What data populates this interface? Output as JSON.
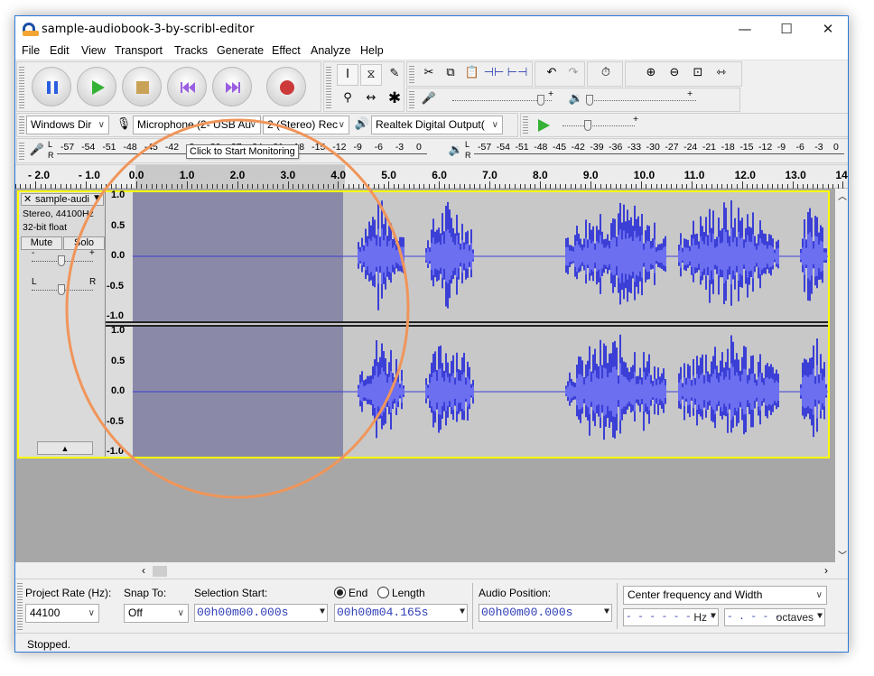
{
  "window": {
    "title": "sample-audiobook-3-by-scribl-editor",
    "min": "—",
    "max": "☐",
    "close": "✕"
  },
  "menu": [
    "File",
    "Edit",
    "View",
    "Transport",
    "Tracks",
    "Generate",
    "Effect",
    "Analyze",
    "Help"
  ],
  "tools": {
    "plus": "+"
  },
  "device": {
    "host": "Windows Dir",
    "input": "Microphone (2- USB Au",
    "channels": "2 (Stereo) Rec",
    "output": "Realtek Digital Output("
  },
  "meters": {
    "record_ticks": [
      "-57",
      "-54",
      "-51",
      "-48",
      "-45",
      "-42",
      "-3",
      "-30",
      "-27",
      "-24",
      "-21",
      "-18",
      "-15",
      "-12",
      "-9",
      "-6",
      "-3",
      "0"
    ],
    "play_ticks": [
      "-57",
      "-54",
      "-51",
      "-48",
      "-45",
      "-42",
      "-39",
      "-36",
      "-33",
      "-30",
      "-27",
      "-24",
      "-21",
      "-18",
      "-15",
      "-12",
      "-9",
      "-6",
      "-3",
      "0"
    ],
    "tooltip": "Click to Start Monitoring",
    "rec_left": "L",
    "rec_right": "R"
  },
  "timeline": {
    "ticks": [
      "- 2.0",
      "- 1.0",
      "0.0",
      "1.0",
      "2.0",
      "3.0",
      "4.0",
      "5.0",
      "6.0",
      "7.0",
      "8.0",
      "9.0",
      "10.0",
      "11.0",
      "12.0",
      "13.0",
      "14.0"
    ]
  },
  "track": {
    "name": "sample-audi",
    "info1": "Stereo, 44100Hz",
    "info2": "32-bit float",
    "mute": "Mute",
    "solo": "Solo",
    "minus": "-",
    "plus": "+",
    "pan_left": "L",
    "pan_right": "R",
    "collapse": "▲",
    "scale": [
      "1.0",
      "0.5",
      "0.0",
      "-0.5",
      "-1.0"
    ]
  },
  "bottom": {
    "rate_label": "Project Rate (Hz):",
    "rate_value": "44100",
    "snap_label": "Snap To:",
    "snap_value": "Off",
    "sel_start_label": "Selection Start:",
    "sel_start": "00h00m00.000s",
    "end_label": "End",
    "length_label": "Length",
    "end_value": "00h00m04.165s",
    "audio_pos_label": "Audio Position:",
    "audio_pos": "00h00m00.000s",
    "spectral": "Center frequency and Width",
    "hz_value": "- - - - - - . - -",
    "hz_unit": "Hz",
    "oct_value": "- . - - -",
    "oct_unit": "octaves"
  },
  "status": "Stopped.",
  "colors": {
    "waveform": "#3b3fd6",
    "waveform_rms": "#6b6ff0",
    "selection": "#8a8aa8",
    "track_bg": "#c4c4c4",
    "annotation_circle": "#f0955a"
  }
}
